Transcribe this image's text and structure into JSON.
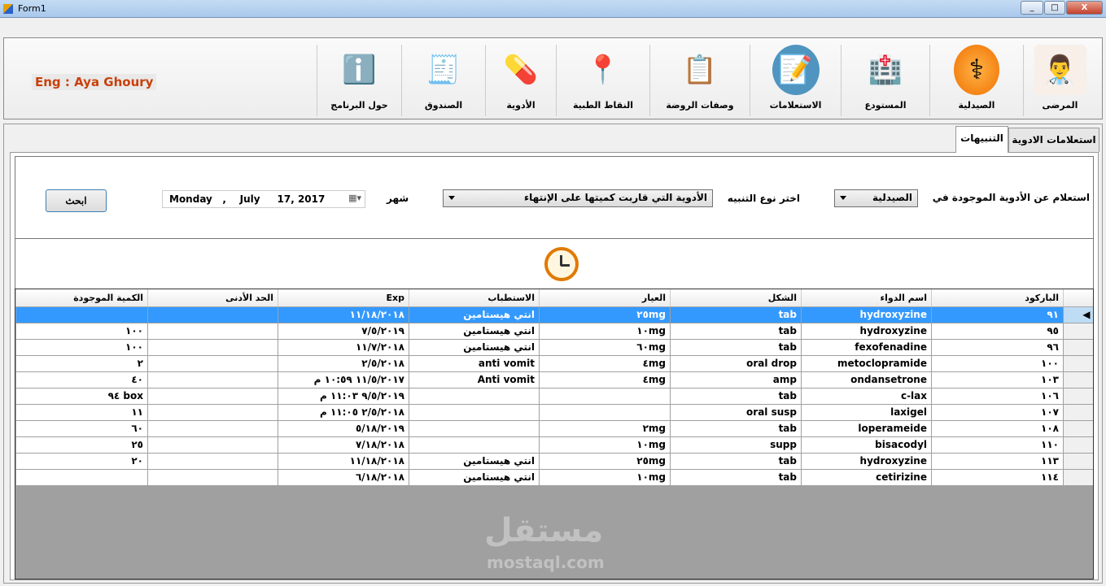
{
  "window": {
    "title": "Form1",
    "minimize": "_",
    "maximize": "□",
    "close": "X"
  },
  "brand": "Eng : Aya Ghoury",
  "toolbar": [
    {
      "label": "المرضى",
      "icon": "doctor-icon"
    },
    {
      "label": "الصيدلية",
      "icon": "pharmacy-icon"
    },
    {
      "label": "المستودع",
      "icon": "warehouse-icon"
    },
    {
      "label": "الاستعلامات",
      "icon": "queries-icon"
    },
    {
      "label": "وصفات الروضة",
      "icon": "prescription-icon"
    },
    {
      "label": "النقاط الطبية",
      "icon": "medical-points-icon"
    },
    {
      "label": "الأدوية",
      "icon": "medicines-icon"
    },
    {
      "label": "الصندوق",
      "icon": "cash-register-icon"
    },
    {
      "label": "حول البرنامج",
      "icon": "about-icon"
    }
  ],
  "tabs": [
    {
      "label": "استعلامات الادوية"
    },
    {
      "label": "التنبيهات"
    }
  ],
  "form": {
    "query_label": "استعلام عن الأدوية الموجودة في",
    "location_value": "الصيدلية",
    "alert_type_label": "اختر نوع التنبيه",
    "alert_type_value": "الأدوية التي قاربت كميتها على الإنتهاء",
    "month_label": "شهر",
    "date_value": "Monday   ,    July     17, 2017",
    "search_button": "ابحث"
  },
  "grid": {
    "columns": [
      "الباركود",
      "اسم الدواء",
      "الشكل",
      "العيار",
      "الاستطباب",
      "Exp",
      "الحد الأدنى",
      "الكمية الموجودة"
    ],
    "rows": [
      [
        "٩١",
        "hydroxyzine",
        "tab",
        "٢٥mg",
        "انتي هيستامين",
        "١١/١٨/٢٠١٨",
        "",
        ""
      ],
      [
        "٩٥",
        "hydroxyzine",
        "tab",
        "١٠mg",
        "انتي هيستامين",
        "٧/٥/٢٠١٩",
        "",
        "١٠٠"
      ],
      [
        "٩٦",
        "fexofenadine",
        "tab",
        "٦٠mg",
        "انتي هيستامين",
        "١١/٧/٢٠١٨",
        "",
        "١٠٠"
      ],
      [
        "١٠٠",
        "metoclopramide",
        "oral drop",
        "٤mg",
        "anti vomit",
        "٢/٥/٢٠١٨",
        "",
        "٢"
      ],
      [
        "١٠٣",
        "ondansetrone",
        "amp",
        "٤mg",
        "Anti vomit",
        "١١/٥/٢٠١٧ ١٠:٥٩ م",
        "",
        "٤٠"
      ],
      [
        "١٠٦",
        "c-lax",
        "tab",
        "",
        "",
        "٩/٥/٢٠١٩ ١١:٠٣ م",
        "",
        "box ٩٤"
      ],
      [
        "١٠٧",
        "laxigel",
        "oral susp",
        "",
        "",
        "٢/٥/٢٠١٨ ١١:٠٥ م",
        "",
        "١١"
      ],
      [
        "١٠٨",
        "loperameide",
        "tab",
        "٢mg",
        "",
        "٥/١٨/٢٠١٩",
        "",
        "٦٠"
      ],
      [
        "١١٠",
        "bisacodyl",
        "supp",
        "١٠mg",
        "",
        "٧/١٨/٢٠١٨",
        "",
        "٢٥"
      ],
      [
        "١١٣",
        "hydroxyzine",
        "tab",
        "٢٥mg",
        "انتي هيستامين",
        "١١/١٨/٢٠١٨",
        "",
        "٢٠"
      ],
      [
        "١١٤",
        "cetirizine",
        "tab",
        "١٠mg",
        "انتي هيستامين",
        "٦/١٨/٢٠١٨",
        "",
        ""
      ]
    ]
  },
  "watermark": {
    "ar": "مستقل",
    "en": "mostaql.com"
  }
}
